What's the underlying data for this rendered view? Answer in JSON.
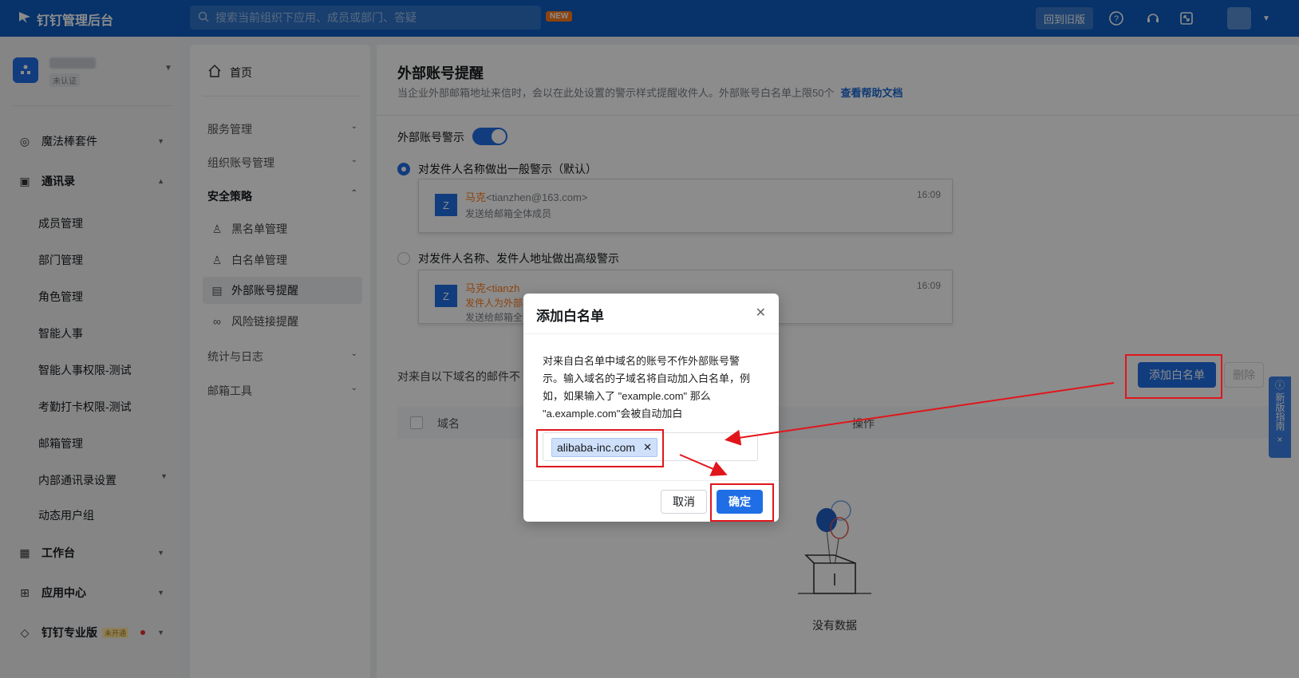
{
  "topbar": {
    "brand": "钉钉管理后台",
    "search_placeholder": "搜索当前组织下应用、成员或部门、答疑",
    "new_badge": "NEW",
    "old_version": "回到旧版"
  },
  "org": {
    "badge": "未认证"
  },
  "sidebar": {
    "items": [
      {
        "label": "魔法棒套件"
      },
      {
        "label": "通讯录"
      },
      {
        "label": "工作台"
      },
      {
        "label": "应用中心"
      },
      {
        "label": "钉钉专业版"
      }
    ],
    "sub_items": [
      "成员管理",
      "部门管理",
      "角色管理",
      "智能人事",
      "智能人事权限-测试",
      "考勤打卡权限-测试",
      "邮箱管理",
      "内部通讯录设置",
      "动态用户组"
    ],
    "pro_tag": "未开通"
  },
  "nav2": {
    "home": "首页",
    "groups": [
      "服务管理",
      "组织账号管理",
      "安全策略",
      "统计与日志",
      "邮箱工具"
    ],
    "security_items": [
      "黑名单管理",
      "白名单管理",
      "外部账号提醒",
      "风险链接提醒"
    ]
  },
  "main": {
    "title": "外部账号提醒",
    "desc": "当企业外部邮箱地址来信时，会以在此处设置的警示样式提醒收件人。外部账号白名单上限50个",
    "help_link": "查看帮助文档",
    "toggle_label": "外部账号警示",
    "radio1": "对发件人名称做出一般警示（默认）",
    "radio2": "对发件人名称、发件人地址做出高级警示",
    "card1": {
      "avatar": "Z",
      "name": "马克",
      "email": "<tianzhen@163.com>",
      "to": "发送给邮箱全体成员",
      "time": "16:09"
    },
    "card2": {
      "avatar": "Z",
      "name": "马克",
      "email": "<tianzh",
      "warn": "发件人为外部",
      "to": "发送给邮箱全",
      "time": "16:09"
    },
    "whitelist_desc": "对来自以下域名的邮件不",
    "add_button": "添加白名单",
    "delete_button": "删除",
    "col_domain": "域名",
    "col_op": "操作",
    "empty": "没有数据"
  },
  "guide": {
    "text": "新版指南"
  },
  "modal": {
    "title": "添加白名单",
    "body": "对来自白名单中域名的账号不作外部账号警示。输入域名的子域名将自动加入白名单，例如，如果输入了 \"example.com\" 那么 \"a.example.com\"会被自动加白",
    "tag": "alibaba-inc.com",
    "cancel": "取消",
    "ok": "确定"
  },
  "colors": {
    "primary": "#1f6ee6",
    "topbar": "#0d5cc2",
    "annotation": "#e1161b"
  }
}
